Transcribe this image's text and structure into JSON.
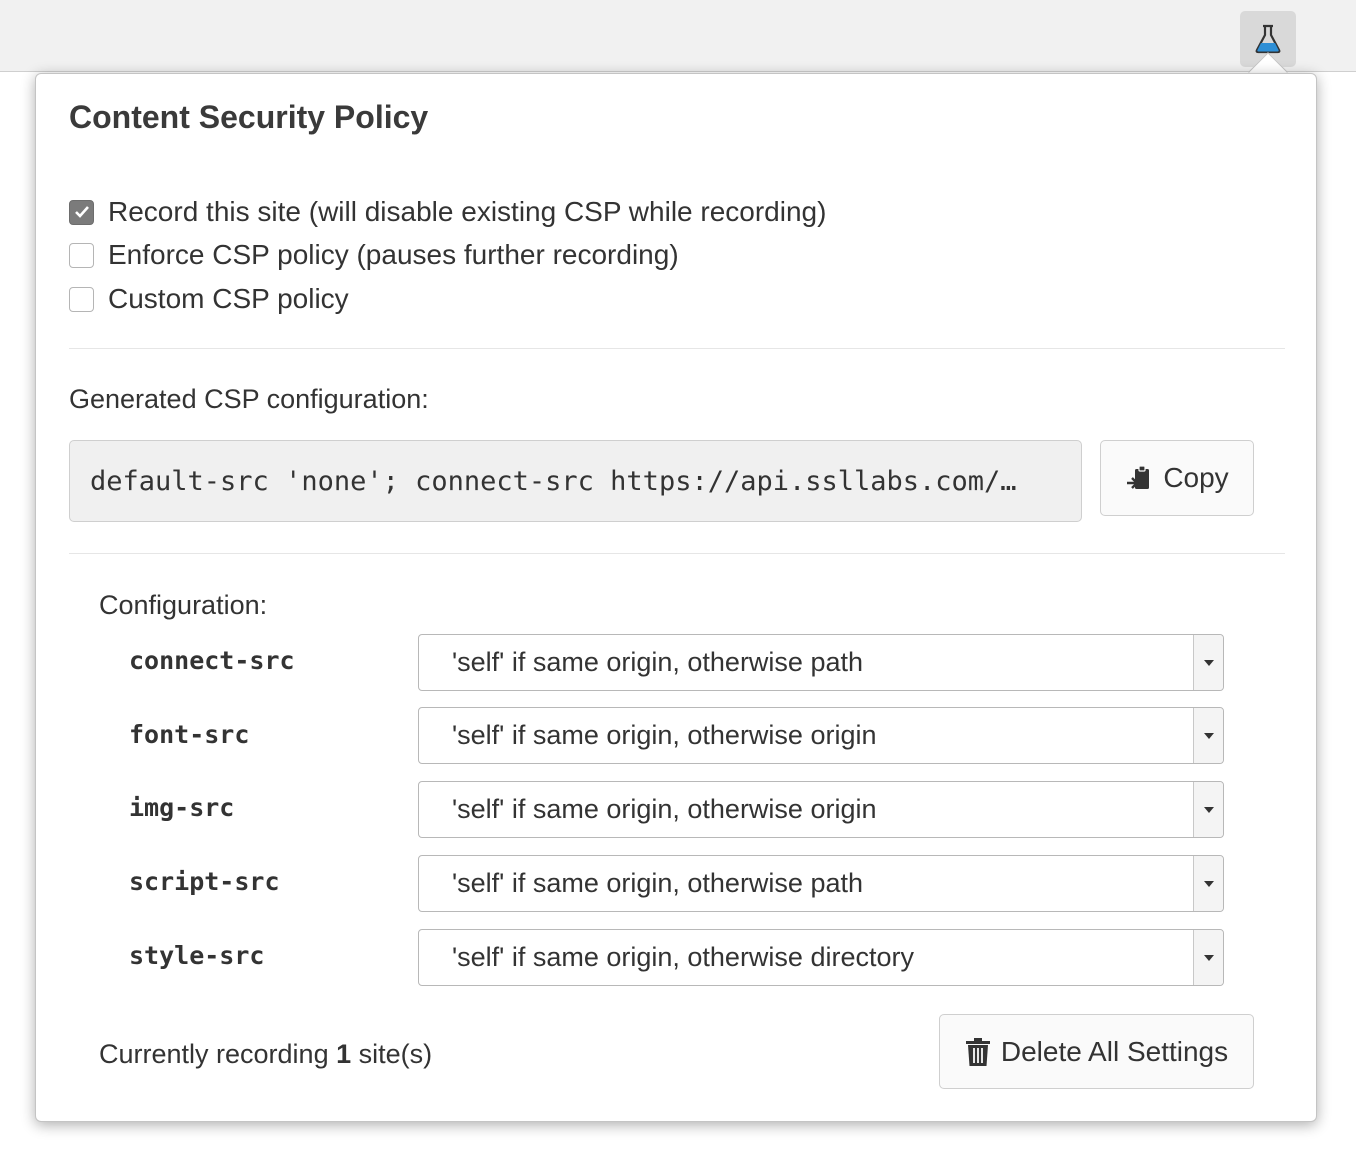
{
  "popup": {
    "title": "Content Security Policy",
    "options": [
      {
        "label": "Record this site (will disable existing CSP while recording)",
        "checked": true
      },
      {
        "label": "Enforce CSP policy (pauses further recording)",
        "checked": false
      },
      {
        "label": "Custom CSP policy",
        "checked": false
      }
    ],
    "generated_label": "Generated CSP configuration:",
    "generated_value": "default-src 'none'; connect-src https://api.ssllabs.com/…",
    "copy_label": "Copy",
    "configuration_label": "Configuration:",
    "directives": [
      {
        "name": "connect-src",
        "value": "'self' if same origin, otherwise path"
      },
      {
        "name": "font-src",
        "value": "'self' if same origin, otherwise origin"
      },
      {
        "name": "img-src",
        "value": "'self' if same origin, otherwise origin"
      },
      {
        "name": "script-src",
        "value": "'self' if same origin, otherwise path"
      },
      {
        "name": "style-src",
        "value": "'self' if same origin, otherwise directory"
      }
    ],
    "footer": {
      "prefix": "Currently recording ",
      "count": "1",
      "suffix": " site(s)"
    },
    "delete_label": "Delete All Settings"
  },
  "toolbar": {
    "extension_icon": "flask-icon"
  },
  "colors": {
    "flask_liquid": "#2e8fd6",
    "checkbox_checked": "#7b7b7b"
  }
}
